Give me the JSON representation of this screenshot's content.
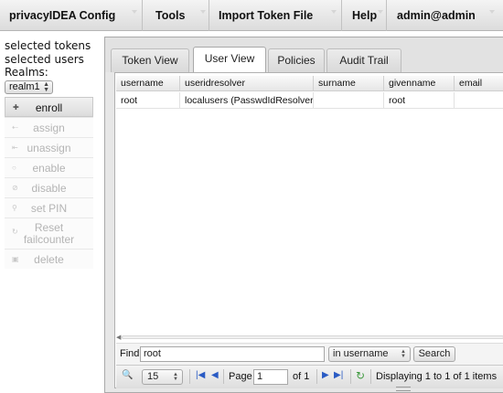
{
  "menu": {
    "items": [
      {
        "label": "privacyIDEA Config"
      },
      {
        "label": "Tools"
      },
      {
        "label": "Import Token File"
      },
      {
        "label": "Help"
      },
      {
        "label": "admin@admin"
      }
    ]
  },
  "sidebar": {
    "selected_tokens": "selected tokens",
    "selected_users": "selected users",
    "realms_label": "Realms:",
    "realm_value": "realm1",
    "actions": [
      {
        "label": "enroll",
        "enabled": true
      },
      {
        "label": "assign",
        "enabled": false
      },
      {
        "label": "unassign",
        "enabled": false
      },
      {
        "label": "enable",
        "enabled": false
      },
      {
        "label": "disable",
        "enabled": false
      },
      {
        "label": "set PIN",
        "enabled": false
      },
      {
        "label": "Reset failcounter",
        "line1": "Reset",
        "line2": "failcounter",
        "enabled": false
      },
      {
        "label": "delete",
        "enabled": false
      }
    ]
  },
  "tabs": [
    {
      "label": "Token View",
      "active": false
    },
    {
      "label": "User View",
      "active": true
    },
    {
      "label": "Policies",
      "active": false
    },
    {
      "label": "Audit Trail",
      "active": false
    }
  ],
  "grid": {
    "columns": [
      "username",
      "useridresolver",
      "surname",
      "givenname",
      "email"
    ],
    "rows": [
      [
        "root",
        "localusers (PasswdIdResolver)",
        "",
        "root",
        ""
      ]
    ]
  },
  "find": {
    "label": "Find",
    "value": "root",
    "field_option": "in username",
    "button": "Search"
  },
  "pager": {
    "page_size": "15",
    "page_label": "Page",
    "page_value": "1",
    "of_label": "of 1",
    "status": "Displaying 1 to 1 of 1 items"
  },
  "colors": {
    "accent_icon": "#2a5bc4",
    "disabled_text": "#b4b4b4"
  }
}
